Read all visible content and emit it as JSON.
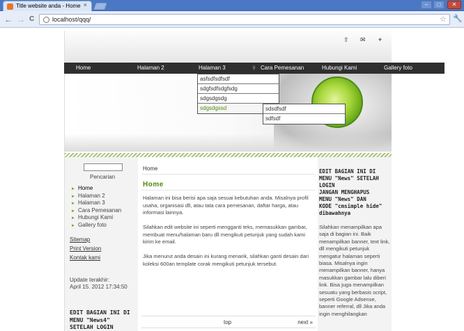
{
  "browser": {
    "tab_title": "Title website anda - Home",
    "tab_close": "×",
    "url": "localhost/qqq/",
    "back_glyph": "←",
    "forward_glyph": "→",
    "reload_glyph": "C",
    "star_glyph": "☆",
    "wrench_glyph": "🔧",
    "min_glyph": "–",
    "max_glyph": "□",
    "close_glyph": "✕"
  },
  "top_icons": {
    "up": "⇧",
    "mail": "✉",
    "target": "⌖"
  },
  "menu": {
    "items": [
      "Home",
      "Halaman 2",
      "Halaman 3",
      "Cara Pemesanan",
      "Hubungi Kami",
      "Gallery foto"
    ],
    "arrow": "⊽"
  },
  "dropdown": {
    "items": [
      "asfsdfsdfsdf",
      "sdgfsdfsdgfsdg",
      "sdgsdgsdg",
      "sdgsdgssd"
    ],
    "sub_items": [
      "sdsdfsdf",
      "sdfsdf"
    ]
  },
  "sidebar": {
    "search_label": "Pencarian",
    "nav": [
      "Home",
      "Halaman 2",
      "Halaman 3",
      "Cara Pemesanan",
      "Hubungi Kami",
      "Gallery foto"
    ],
    "bullet": "►",
    "links": [
      "Sitemap",
      "Print Version",
      "Kontak kami"
    ],
    "updated_label": "Update terakhir:",
    "updated_value": "April 15. 2012 17:34:50",
    "edit_lines": [
      "EDIT BAGIAN INI DI",
      "MENU \"News4\"",
      "SETELAH LOGIN"
    ]
  },
  "content": {
    "breadcrumb": "Home",
    "title": "Home",
    "paragraphs": [
      "Halaman ini bisa berisi apa saja sesuai kebutuhan anda. Misalnya profil usaha, organisasi dll, atau tata cara pemesanan, daftar harga, atau informasi lainnya.",
      "Silahkan edit website ini seperti mengganti teks, memasukkan gambar, membuat menu/halaman baru dll mengikuti petunjuk yang sudah kami kirim ke email.",
      "Jika menurut anda desain ini kurang menarik, silahkan ganti desain dari koleksi 600an template corak mengikuti petunjuk tersebut."
    ],
    "pager_top": "top",
    "pager_next": "next »"
  },
  "right": {
    "edit_lines": [
      "EDIT BAGIAN INI DI",
      "MENU \"News\" SETELAH",
      "LOGIN",
      "JANGAN MENGHAPUS",
      "MENU \"News\" DAN",
      "KODE \"cmsimple hide\"",
      "dibawahnya"
    ],
    "body": "Silahkan menampilkan apa saja di bagian ini. Baik menampilkan banner, text link, dll mengikuti petunjuk mengatur halaman seperti biasa. Misalnya ingin menampilkan banner, hanya masukkan gambar lalu diberi link. Bisa juga menampilkan sesuatu yang berbasis script, seperti Google Adsense, banner referral, dll Jika anda ingin menghilangkan"
  }
}
